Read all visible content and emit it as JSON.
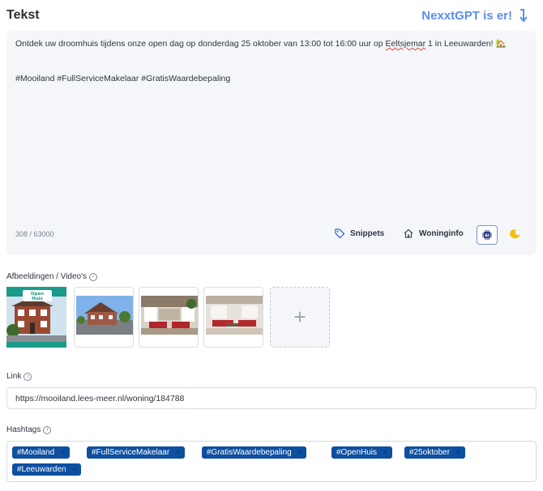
{
  "header": {
    "title": "Tekst",
    "gpt_link": "NexxtGPT is er!"
  },
  "editor": {
    "text_before": "Ontdek uw droomhuis tijdens onze open dag op donderdag 25 oktober van 13:00 tot 16:00 uur op ",
    "text_misspelled": "Eeltsjemar",
    "text_after": " 1 in Leeuwarden! 🏡",
    "hashtag_line": "#Mooiland #FullServiceMakelaar #GratisWaardebepaling",
    "counter": "308 / 63000",
    "snippets_label": "Snippets",
    "woninginfo_label": "Woninginfo",
    "ai_label": "AI"
  },
  "media": {
    "label": "Afbeeldingen / Video's",
    "open_house_badge_line1": "Open",
    "open_house_badge_line2": "Huis",
    "add_symbol": "+"
  },
  "link": {
    "label": "Link",
    "value": "https://mooiland.lees-meer.nl/woning/184788"
  },
  "hashtags": {
    "label": "Hashtags",
    "items": [
      "#Mooiland",
      "#FullServiceMakelaar",
      "#GratisWaardebepaling",
      "#OpenHuis",
      "#25oktober",
      "#Leeuwarden"
    ],
    "remove_symbol": "×"
  },
  "colors": {
    "accent": "#5b8def",
    "tag_bg": "#0d4fa0",
    "editor_bg": "#f4f6f9"
  }
}
